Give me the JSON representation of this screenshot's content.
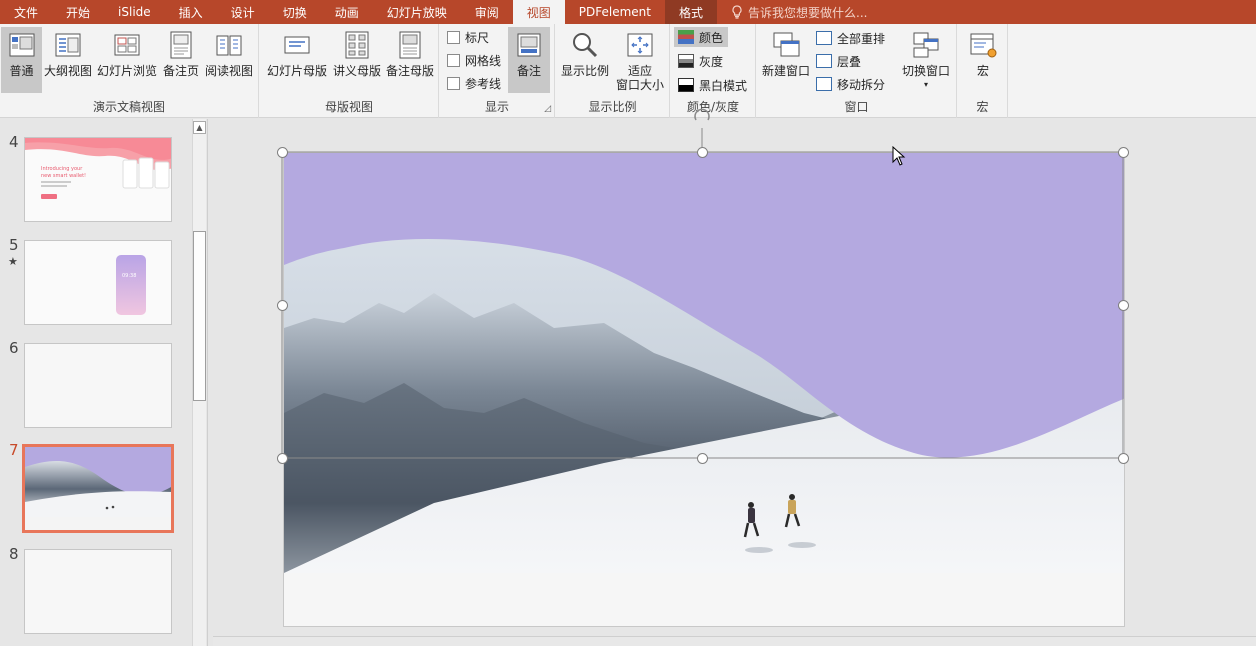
{
  "menu": {
    "tabs": [
      "文件",
      "开始",
      "iSlide",
      "插入",
      "设计",
      "切换",
      "动画",
      "幻灯片放映",
      "审阅",
      "视图",
      "PDFelement",
      "格式"
    ],
    "active_tab": "视图",
    "tell_me": "告诉我您想要做什么..."
  },
  "ribbon": {
    "presentation_views": {
      "label": "演示文稿视图",
      "buttons": [
        "普通",
        "大纲视图",
        "幻灯片浏览",
        "备注页",
        "阅读视图"
      ],
      "selected": "普通"
    },
    "master_views": {
      "label": "母版视图",
      "buttons": [
        "幻灯片母版",
        "讲义母版",
        "备注母版"
      ]
    },
    "show": {
      "label": "显示",
      "checkboxes": [
        "标尺",
        "网格线",
        "参考线"
      ],
      "notes_button": "备注"
    },
    "zoom": {
      "label": "显示比例",
      "zoom_button": "显示比例",
      "fit_line1": "适应",
      "fit_line2": "窗口大小"
    },
    "color": {
      "label": "颜色/灰度",
      "options": [
        "颜色",
        "灰度",
        "黑白模式"
      ],
      "selected": "颜色"
    },
    "window": {
      "label": "窗口",
      "new_window": "新建窗口",
      "arrange_all": "全部重排",
      "cascade": "层叠",
      "move_split": "移动拆分",
      "switch_window": "切换窗口"
    },
    "macros": {
      "label": "宏",
      "button": "宏"
    }
  },
  "thumbnails": [
    {
      "number": "4",
      "starred": false,
      "active": false
    },
    {
      "number": "5",
      "starred": true,
      "active": false
    },
    {
      "number": "6",
      "starred": false,
      "active": false
    },
    {
      "number": "7",
      "starred": false,
      "active": true
    },
    {
      "number": "8",
      "starred": false,
      "active": false
    }
  ],
  "thumb_texts": {
    "slide4_heading_line1": "Introducing your",
    "slide4_heading_line2": "new smart wallet!",
    "slide5_time": "09:38"
  },
  "star_glyph": "★",
  "colors": {
    "accent": "#b7472a",
    "wave_purple": "#b4a9e0",
    "selection_border": "#e8765a"
  }
}
